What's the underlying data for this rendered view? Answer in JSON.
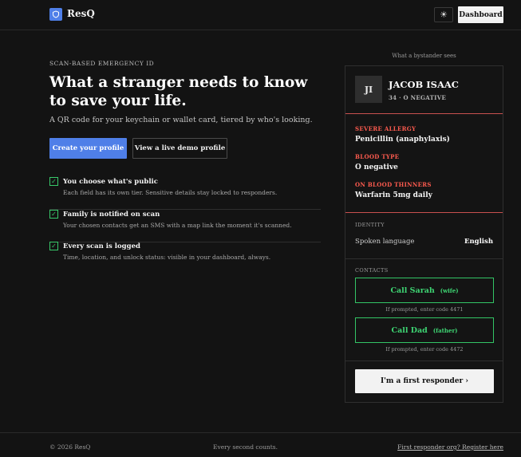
{
  "header": {
    "logo_icon": "shield-icon",
    "brand": "ResQ",
    "theme_icon": "sun-icon",
    "theme_glyph": "☀",
    "dashboard_label": "Dashboard"
  },
  "hero": {
    "eyebrow": "SCAN-BASED EMERGENCY ID",
    "headline": "What a stranger needs to know to save your life.",
    "subtitle": "A QR code for your keychain or wallet card, tiered by who's looking.",
    "primary_cta": "Create your profile",
    "secondary_cta": "View a live demo profile"
  },
  "features": [
    {
      "title": "You choose what's public",
      "description": "Each field has its own tier. Sensitive details stay locked to responders."
    },
    {
      "title": "Family is notified on scan",
      "description": "Your chosen contacts get an SMS with a map link the moment it's scanned."
    },
    {
      "title": "Every scan is logged",
      "description": "Time, location, and unlock status: visible in your dashboard, always."
    }
  ],
  "check_glyph": "✓",
  "preview": {
    "caption": "What a bystander sees",
    "initials": "JI",
    "name": "JACOB ISAAC",
    "meta": "34 · O NEGATIVE",
    "critical": [
      {
        "label": "SEVERE ALLERGY",
        "value": "Penicillin (anaphylaxis)"
      },
      {
        "label": "BLOOD TYPE",
        "value": "O negative"
      },
      {
        "label": "ON BLOOD THINNERS",
        "value": "Warfarin 5mg daily"
      }
    ],
    "identity_label": "IDENTITY",
    "identity_key": "Spoken language",
    "identity_value": "English",
    "contacts_label": "CONTACTS",
    "contacts": [
      {
        "name": "Call Sarah",
        "relation": "(wife)",
        "hint": "If prompted, enter code 4471"
      },
      {
        "name": "Call Dad",
        "relation": "(father)",
        "hint": "If prompted, enter code 4472"
      }
    ],
    "responder_cta": "I'm a first responder ›"
  },
  "footer": {
    "copyright": "© 2026 ResQ",
    "tagline": "Every second counts.",
    "link": "First responder org? Register here"
  },
  "colors": {
    "accent": "#4f7fe8",
    "danger": "#ff5b4f",
    "success": "#38c96a",
    "background": "#131313"
  }
}
